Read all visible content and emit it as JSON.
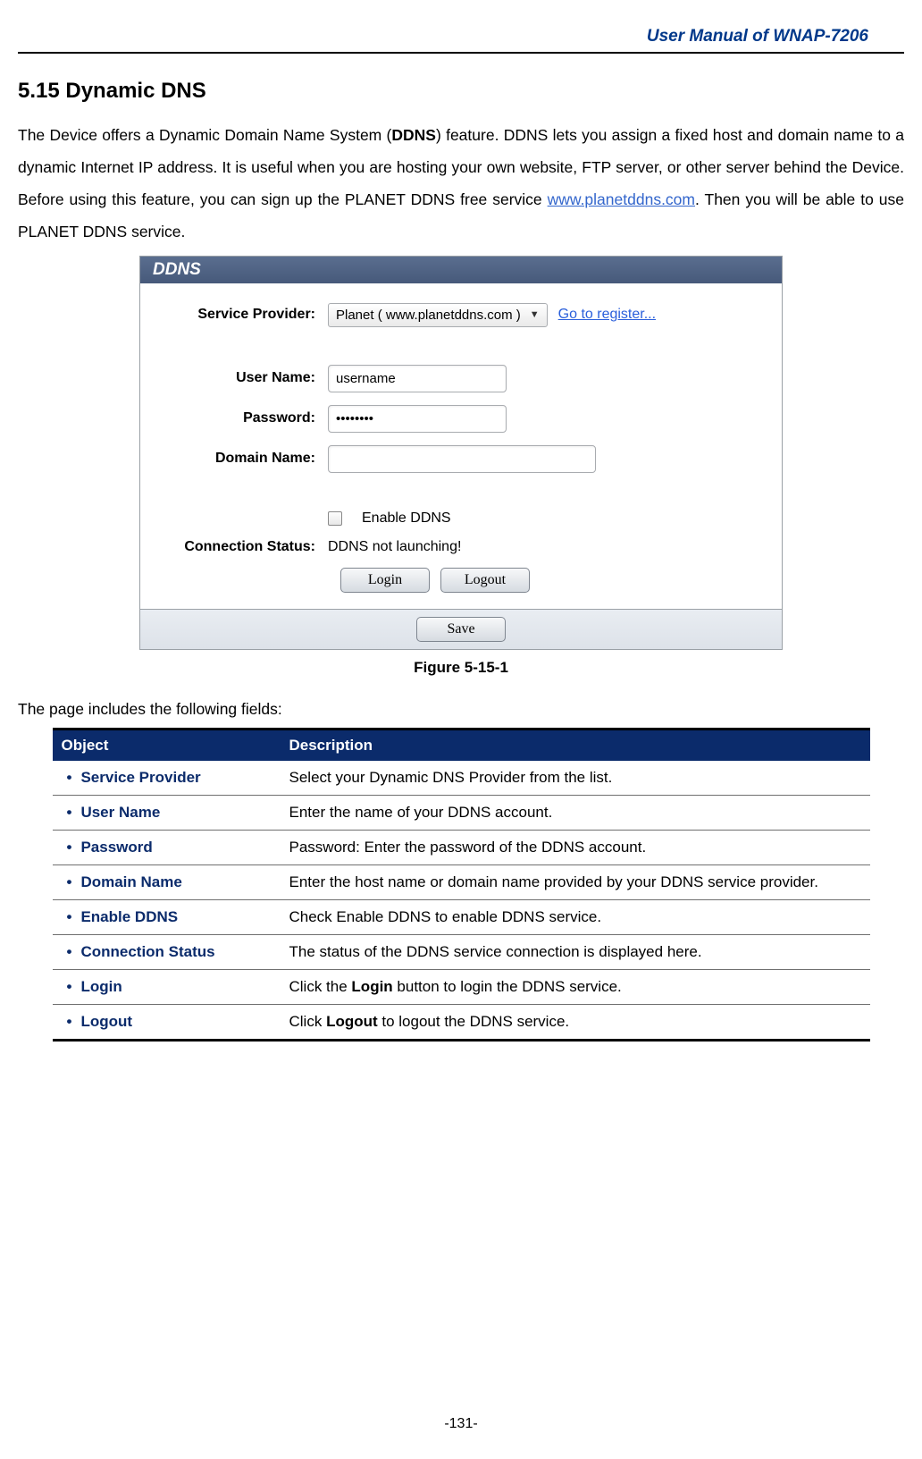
{
  "header": {
    "manual_title": "User Manual of WNAP-7206"
  },
  "section": {
    "number_title": "5.15  Dynamic DNS",
    "intro_html": "The Device offers a Dynamic Domain Name System (<b>DDNS</b>) feature. DDNS lets you assign a fixed host and domain name to a dynamic Internet IP address. It is useful when you are hosting your own website, FTP server, or other server behind the Device. Before using this feature, you can sign up the PLANET DDNS free service <a href='#' data-name='planetddns-link' data-interactable='true'>www.planetddns.com</a>. Then you will be able to use PLANET DDNS service."
  },
  "figure": {
    "panel_title": "DDNS",
    "labels": {
      "service_provider": "Service Provider:",
      "user_name": "User Name:",
      "password": "Password:",
      "domain_name": "Domain Name:",
      "connection_status": "Connection Status:"
    },
    "values": {
      "provider_selected": "Planet ( www.planetddns.com )",
      "register_link": "Go to register...",
      "username": "username",
      "password_masked": "••••••••",
      "domain": "",
      "enable_label": "Enable DDNS",
      "status": "DDNS not launching!",
      "login_btn": "Login",
      "logout_btn": "Logout",
      "save_btn": "Save"
    },
    "caption": "Figure 5-15-1"
  },
  "fields": {
    "intro": "The page includes the following fields:",
    "headers": {
      "object": "Object",
      "description": "Description"
    },
    "rows": [
      {
        "object": "Service Provider",
        "desc_html": "Select your Dynamic DNS Provider from the list."
      },
      {
        "object": "User Name",
        "desc_html": "Enter the name of your DDNS account."
      },
      {
        "object": "Password",
        "desc_html": "Password: Enter the password of the DDNS account."
      },
      {
        "object": "Domain Name",
        "desc_html": "Enter the host name or domain name provided by your DDNS service provider."
      },
      {
        "object": "Enable DDNS",
        "desc_html": "Check Enable DDNS to enable DDNS service."
      },
      {
        "object": "Connection Status",
        "desc_html": "The status of the DDNS service connection is displayed here."
      },
      {
        "object": "Login",
        "desc_html": "Click the <span class='b'>Login</span> button to login the DDNS service."
      },
      {
        "object": "Logout",
        "desc_html": "Click <span class='b'>Logout</span> to logout the DDNS service."
      }
    ]
  },
  "footer": {
    "page_number": "-131-"
  }
}
